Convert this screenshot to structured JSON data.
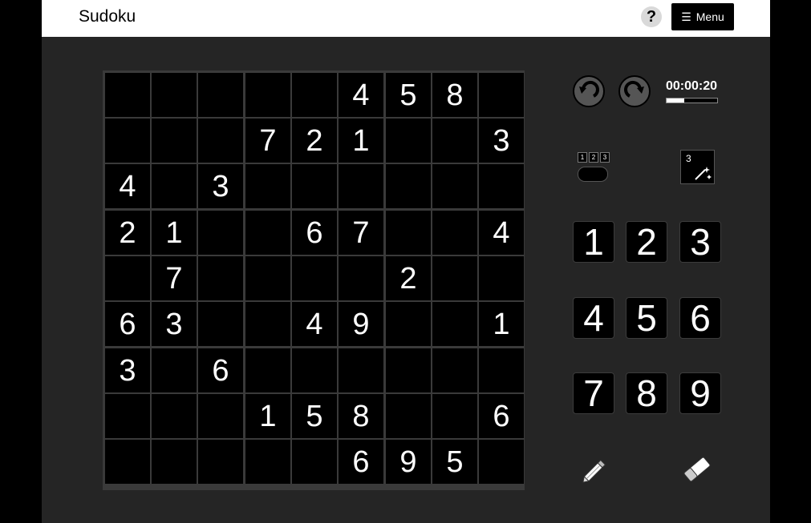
{
  "app": {
    "title": "Sudoku"
  },
  "header": {
    "help_label": "?",
    "menu_label": "Menu",
    "menu_icon": "hamburger-icon"
  },
  "board": {
    "cells": [
      [
        "",
        "",
        "",
        "",
        "",
        "4",
        "5",
        "8",
        ""
      ],
      [
        "",
        "",
        "",
        "7",
        "2",
        "1",
        "",
        "",
        "3"
      ],
      [
        "4",
        "",
        "3",
        "",
        "",
        "",
        "",
        "",
        ""
      ],
      [
        "2",
        "1",
        "",
        "",
        "6",
        "7",
        "",
        "",
        "4"
      ],
      [
        "",
        "7",
        "",
        "",
        "",
        "",
        "2",
        "",
        ""
      ],
      [
        "6",
        "3",
        "",
        "",
        "4",
        "9",
        "",
        "",
        "1"
      ],
      [
        "3",
        "",
        "6",
        "",
        "",
        "",
        "",
        "",
        ""
      ],
      [
        "",
        "",
        "",
        "1",
        "5",
        "8",
        "",
        "",
        "6"
      ],
      [
        "",
        "",
        "",
        "",
        "",
        "6",
        "9",
        "5",
        ""
      ]
    ]
  },
  "controls": {
    "undo_icon": "undo-icon",
    "redo_icon": "redo-icon",
    "timer": "00:00:20",
    "timer_progress": 0.35,
    "notes_toggle": {
      "digits": [
        "1",
        "2",
        "3"
      ],
      "on": false
    },
    "hint": {
      "digit": "3",
      "icon": "magic-wand-icon"
    },
    "number_keys": [
      "1",
      "2",
      "3",
      "4",
      "5",
      "6",
      "7",
      "8",
      "9"
    ],
    "pencil_icon": "pencil-icon",
    "eraser_icon": "eraser-icon"
  },
  "colors": {
    "background": "#252525",
    "cell": "#000000",
    "text": "#ffffff",
    "header": "#ffffff"
  }
}
